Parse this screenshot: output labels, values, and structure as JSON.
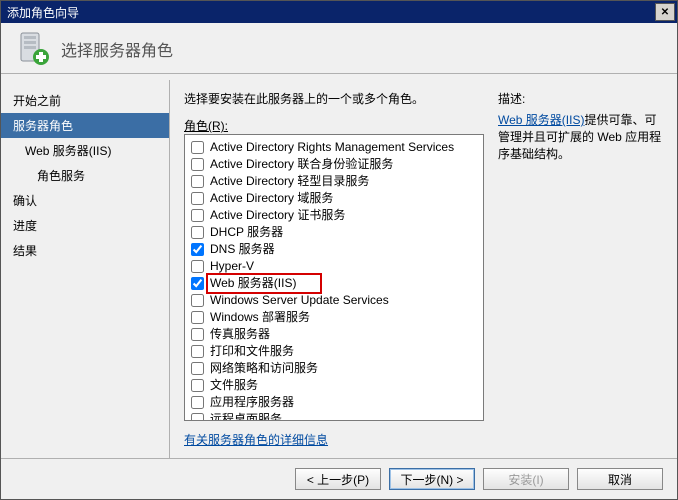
{
  "window": {
    "title": "添加角色向导"
  },
  "header": {
    "text": "选择服务器角色"
  },
  "nav": {
    "items": [
      {
        "label": "开始之前",
        "cls": "plain"
      },
      {
        "label": "服务器角色",
        "cls": "sel"
      },
      {
        "label": "Web 服务器(IIS)",
        "cls": "plain indent1"
      },
      {
        "label": "角色服务",
        "cls": "plain indent2"
      },
      {
        "label": "确认",
        "cls": "plain"
      },
      {
        "label": "进度",
        "cls": "plain"
      },
      {
        "label": "结果",
        "cls": "plain"
      }
    ]
  },
  "main": {
    "instruction": "选择要安装在此服务器上的一个或多个角色。",
    "roles_label": "角色(R):",
    "roles": [
      {
        "label": "Active Directory Rights Management Services",
        "checked": false
      },
      {
        "label": "Active Directory 联合身份验证服务",
        "checked": false
      },
      {
        "label": "Active Directory 轻型目录服务",
        "checked": false
      },
      {
        "label": "Active Directory 域服务",
        "checked": false
      },
      {
        "label": "Active Directory 证书服务",
        "checked": false
      },
      {
        "label": "DHCP 服务器",
        "checked": false
      },
      {
        "label": "DNS 服务器",
        "checked": true
      },
      {
        "label": "Hyper-V",
        "checked": false
      },
      {
        "label": "Web 服务器(IIS)",
        "checked": true,
        "highlight": true
      },
      {
        "label": "Windows Server Update Services",
        "checked": false
      },
      {
        "label": "Windows 部署服务",
        "checked": false
      },
      {
        "label": "传真服务器",
        "checked": false
      },
      {
        "label": "打印和文件服务",
        "checked": false
      },
      {
        "label": "网络策略和访问服务",
        "checked": false
      },
      {
        "label": "文件服务",
        "checked": false
      },
      {
        "label": "应用程序服务器",
        "checked": false
      },
      {
        "label": "远程桌面服务",
        "checked": false
      }
    ],
    "more_info_link": "有关服务器角色的详细信息"
  },
  "desc": {
    "label": "描述:",
    "link_text": "Web 服务器(IIS)",
    "body_text": "提供可靠、可管理并且可扩展的 Web 应用程序基础结构。"
  },
  "footer": {
    "back": "< 上一步(P)",
    "next": "下一步(N) >",
    "install": "安装(I)",
    "cancel": "取消"
  }
}
